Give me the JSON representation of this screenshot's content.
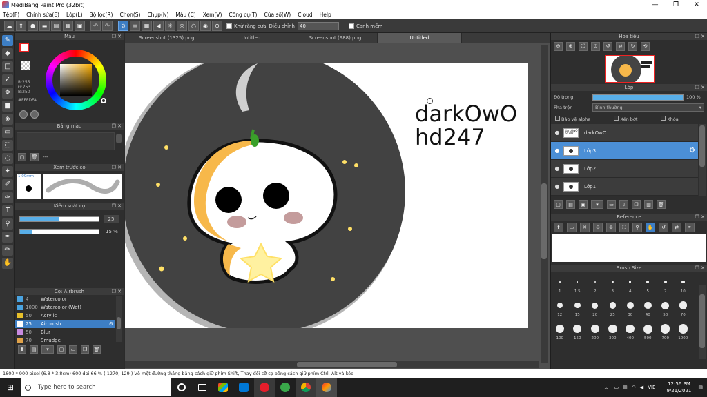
{
  "window": {
    "title": "MediBang Paint Pro (32bit)"
  },
  "menu": [
    "Tệp(F)",
    "Chỉnh sửa(E)",
    "Lớp(L)",
    "Bộ lọc(R)",
    "Chọn(S)",
    "Chụp(N)",
    "Màu (C)",
    "Xem(V)",
    "Công cụ(T)",
    "Cửa sổ(W)",
    "Cloud",
    "Help"
  ],
  "toolbar": {
    "antialias_label": "Khử răng cưa",
    "adjust_label": "Điều chỉnh",
    "adjust_value": "40",
    "smooth_label": "Canh mềm"
  },
  "color_panel": {
    "title": "Màu",
    "rgb": [
      "R:255",
      "G:253",
      "B:250"
    ],
    "hex": "#FFFDFA"
  },
  "palette_panel": {
    "title": "Bảng màu",
    "dash": "---"
  },
  "preview_panel": {
    "title": "Xem trước cọ",
    "size": "1.09mm"
  },
  "control_panel": {
    "title": "Kiểm soát cọ",
    "size_value": "25",
    "opacity_value": "15 %",
    "size_fraction": 0.49,
    "opacity_fraction": 0.15
  },
  "brush_panel": {
    "title": "Cọ: Airbrush",
    "brushes": [
      {
        "size": "4",
        "name": "Watercolor",
        "color": "#4aa3e0"
      },
      {
        "size": "1000",
        "name": "Watercolor (Wet)",
        "color": "#4aa3e0"
      },
      {
        "size": "50",
        "name": "Acrylic",
        "color": "#e8c02a"
      },
      {
        "size": "25",
        "name": "Airbrush",
        "color": "#ffffff",
        "selected": true
      },
      {
        "size": "50",
        "name": "Blur",
        "color": "#c88ae0"
      },
      {
        "size": "70",
        "name": "Smudge",
        "color": "#e0a24a"
      }
    ]
  },
  "tabs": [
    {
      "label": "Screenshot (1325).png"
    },
    {
      "label": "Untitled"
    },
    {
      "label": "Screenshot (988).png"
    },
    {
      "label": "Untitled",
      "active": true
    }
  ],
  "canvas": {
    "text_line1": "darkOwO",
    "text_line2": "hd247"
  },
  "navigator_panel": {
    "title": "Hoa tiêu"
  },
  "layer_panel": {
    "title": "Lớp",
    "opacity_label": "Độ trong",
    "opacity_value": "100 %",
    "blend_label": "Pha trộn",
    "blend_value": "Bình thường",
    "options": [
      "Bảo vệ alpha",
      "Xén bớt",
      "Khóa"
    ],
    "layers": [
      {
        "name": "darkOwO",
        "thumb": "darkOwO hd247"
      },
      {
        "name": "Lớp3",
        "selected": true
      },
      {
        "name": "Lớp2"
      },
      {
        "name": "Lớp1"
      }
    ]
  },
  "reference_panel": {
    "title": "Reference"
  },
  "brush_size_panel": {
    "title": "Brush Size",
    "sizes": [
      "1",
      "1.5",
      "2",
      "3",
      "4",
      "5",
      "7",
      "10",
      "12",
      "15",
      "20",
      "25",
      "30",
      "40",
      "50",
      "70",
      "100",
      "150",
      "200",
      "300",
      "400",
      "500",
      "700",
      "1000"
    ]
  },
  "status": "1600 * 900 pixel   (6.8 * 3.8cm)   600 dpi   66 %   ( 1270, 129 )   Vẽ một đường thẳng bằng cách giữ phím Shift, Thay đổi cỡ cọ bằng cách giữ phím Ctrl, Alt và kéo",
  "taskbar": {
    "search_placeholder": "Type here to search",
    "time": "12:56 PM",
    "date": "9/21/2021",
    "lang": "VIE"
  }
}
